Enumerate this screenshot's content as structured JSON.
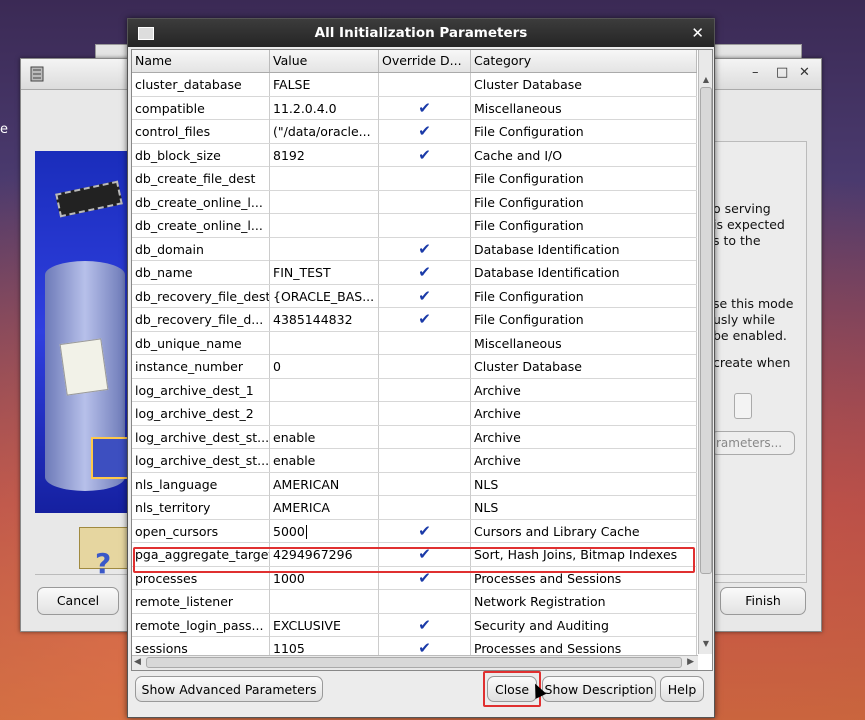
{
  "desktop": {
    "text_fragment": "e"
  },
  "wizard": {
    "right_text_lines": [
      "o serving",
      "is expected",
      "s to the",
      "",
      "se this mode",
      "usly while",
      "be enabled.",
      "create when"
    ],
    "params_button": "rameters...",
    "cancel": "Cancel",
    "finish": "Finish",
    "window_controls": {
      "minimize": "–",
      "maximize": "□",
      "close": "✕"
    }
  },
  "dialog": {
    "title": "All Initialization Parameters",
    "close_glyph": "✕",
    "columns": [
      "Name",
      "Value",
      "Override D...",
      "Category"
    ],
    "rows": [
      {
        "name": "cluster_database",
        "value": "FALSE",
        "override": false,
        "category": "Cluster Database"
      },
      {
        "name": "compatible",
        "value": "11.2.0.4.0",
        "override": true,
        "category": "Miscellaneous"
      },
      {
        "name": "control_files",
        "value": "(\"/data/oracle...",
        "override": true,
        "category": "File Configuration"
      },
      {
        "name": "db_block_size",
        "value": "8192",
        "override": true,
        "category": "Cache and I/O"
      },
      {
        "name": "db_create_file_dest",
        "value": "",
        "override": false,
        "category": "File Configuration"
      },
      {
        "name": "db_create_online_l...",
        "value": "",
        "override": false,
        "category": "File Configuration"
      },
      {
        "name": "db_create_online_l...",
        "value": "",
        "override": false,
        "category": "File Configuration"
      },
      {
        "name": "db_domain",
        "value": "",
        "override": true,
        "category": "Database Identification"
      },
      {
        "name": "db_name",
        "value": "FIN_TEST",
        "override": true,
        "category": "Database Identification"
      },
      {
        "name": "db_recovery_file_dest",
        "value": "{ORACLE_BAS...",
        "override": true,
        "category": "File Configuration"
      },
      {
        "name": "db_recovery_file_d...",
        "value": "4385144832",
        "override": true,
        "category": "File Configuration"
      },
      {
        "name": "db_unique_name",
        "value": "",
        "override": false,
        "category": "Miscellaneous"
      },
      {
        "name": "instance_number",
        "value": "0",
        "override": false,
        "category": "Cluster Database"
      },
      {
        "name": "log_archive_dest_1",
        "value": "",
        "override": false,
        "category": "Archive"
      },
      {
        "name": "log_archive_dest_2",
        "value": "",
        "override": false,
        "category": "Archive"
      },
      {
        "name": "log_archive_dest_st...",
        "value": "enable",
        "override": false,
        "category": "Archive"
      },
      {
        "name": "log_archive_dest_st...",
        "value": "enable",
        "override": false,
        "category": "Archive"
      },
      {
        "name": "nls_language",
        "value": "AMERICAN",
        "override": false,
        "category": "NLS"
      },
      {
        "name": "nls_territory",
        "value": "AMERICA",
        "override": false,
        "category": "NLS"
      },
      {
        "name": "open_cursors",
        "value": "5000",
        "override": true,
        "category": "Cursors and Library Cache"
      },
      {
        "name": "pga_aggregate_target",
        "value": "4294967296",
        "override": true,
        "category": "Sort, Hash Joins, Bitmap Indexes"
      },
      {
        "name": "processes",
        "value": "1000",
        "override": true,
        "category": "Processes and Sessions"
      },
      {
        "name": "remote_listener",
        "value": "",
        "override": false,
        "category": "Network Registration"
      },
      {
        "name": "remote_login_pass...",
        "value": "EXCLUSIVE",
        "override": true,
        "category": "Security and Auditing"
      },
      {
        "name": "sessions",
        "value": "1105",
        "override": true,
        "category": "Processes and Sessions"
      }
    ],
    "check_glyph": "✔",
    "buttons": {
      "advanced": "Show Advanced Parameters",
      "close": "Close",
      "description": "Show Description",
      "help": "Help"
    },
    "colors": {
      "highlight": "#e03030",
      "check": "#1a3aa8",
      "titlebar": "#2e2e2e"
    }
  }
}
